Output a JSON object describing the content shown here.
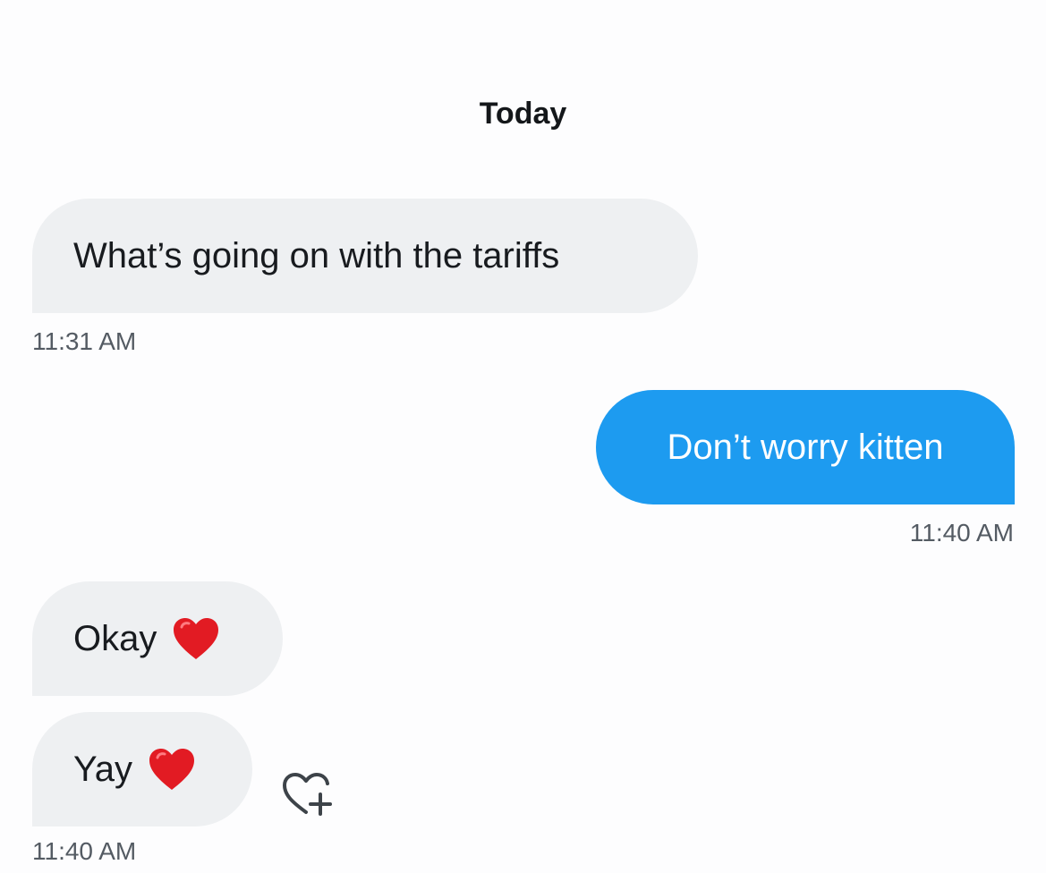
{
  "thread": {
    "date_label": "Today",
    "messages": [
      {
        "direction": "incoming",
        "text": "What’s going on with the tariffs",
        "timestamp": "11:31 AM"
      },
      {
        "direction": "outgoing",
        "text": "Don’t worry kitten",
        "timestamp": "11:40 AM"
      },
      {
        "direction": "incoming",
        "text": "Okay",
        "emoji": "red-heart",
        "timestamp": ""
      },
      {
        "direction": "incoming",
        "text": "Yay",
        "emoji": "red-heart",
        "timestamp": "11:40 AM"
      }
    ]
  },
  "actions": {
    "add_reaction_icon": "heart-plus-icon"
  },
  "colors": {
    "outgoing_bubble": "#1d9bf0",
    "incoming_bubble": "#eef0f2",
    "heart": "#e21b23",
    "timestamp": "#545b63"
  }
}
